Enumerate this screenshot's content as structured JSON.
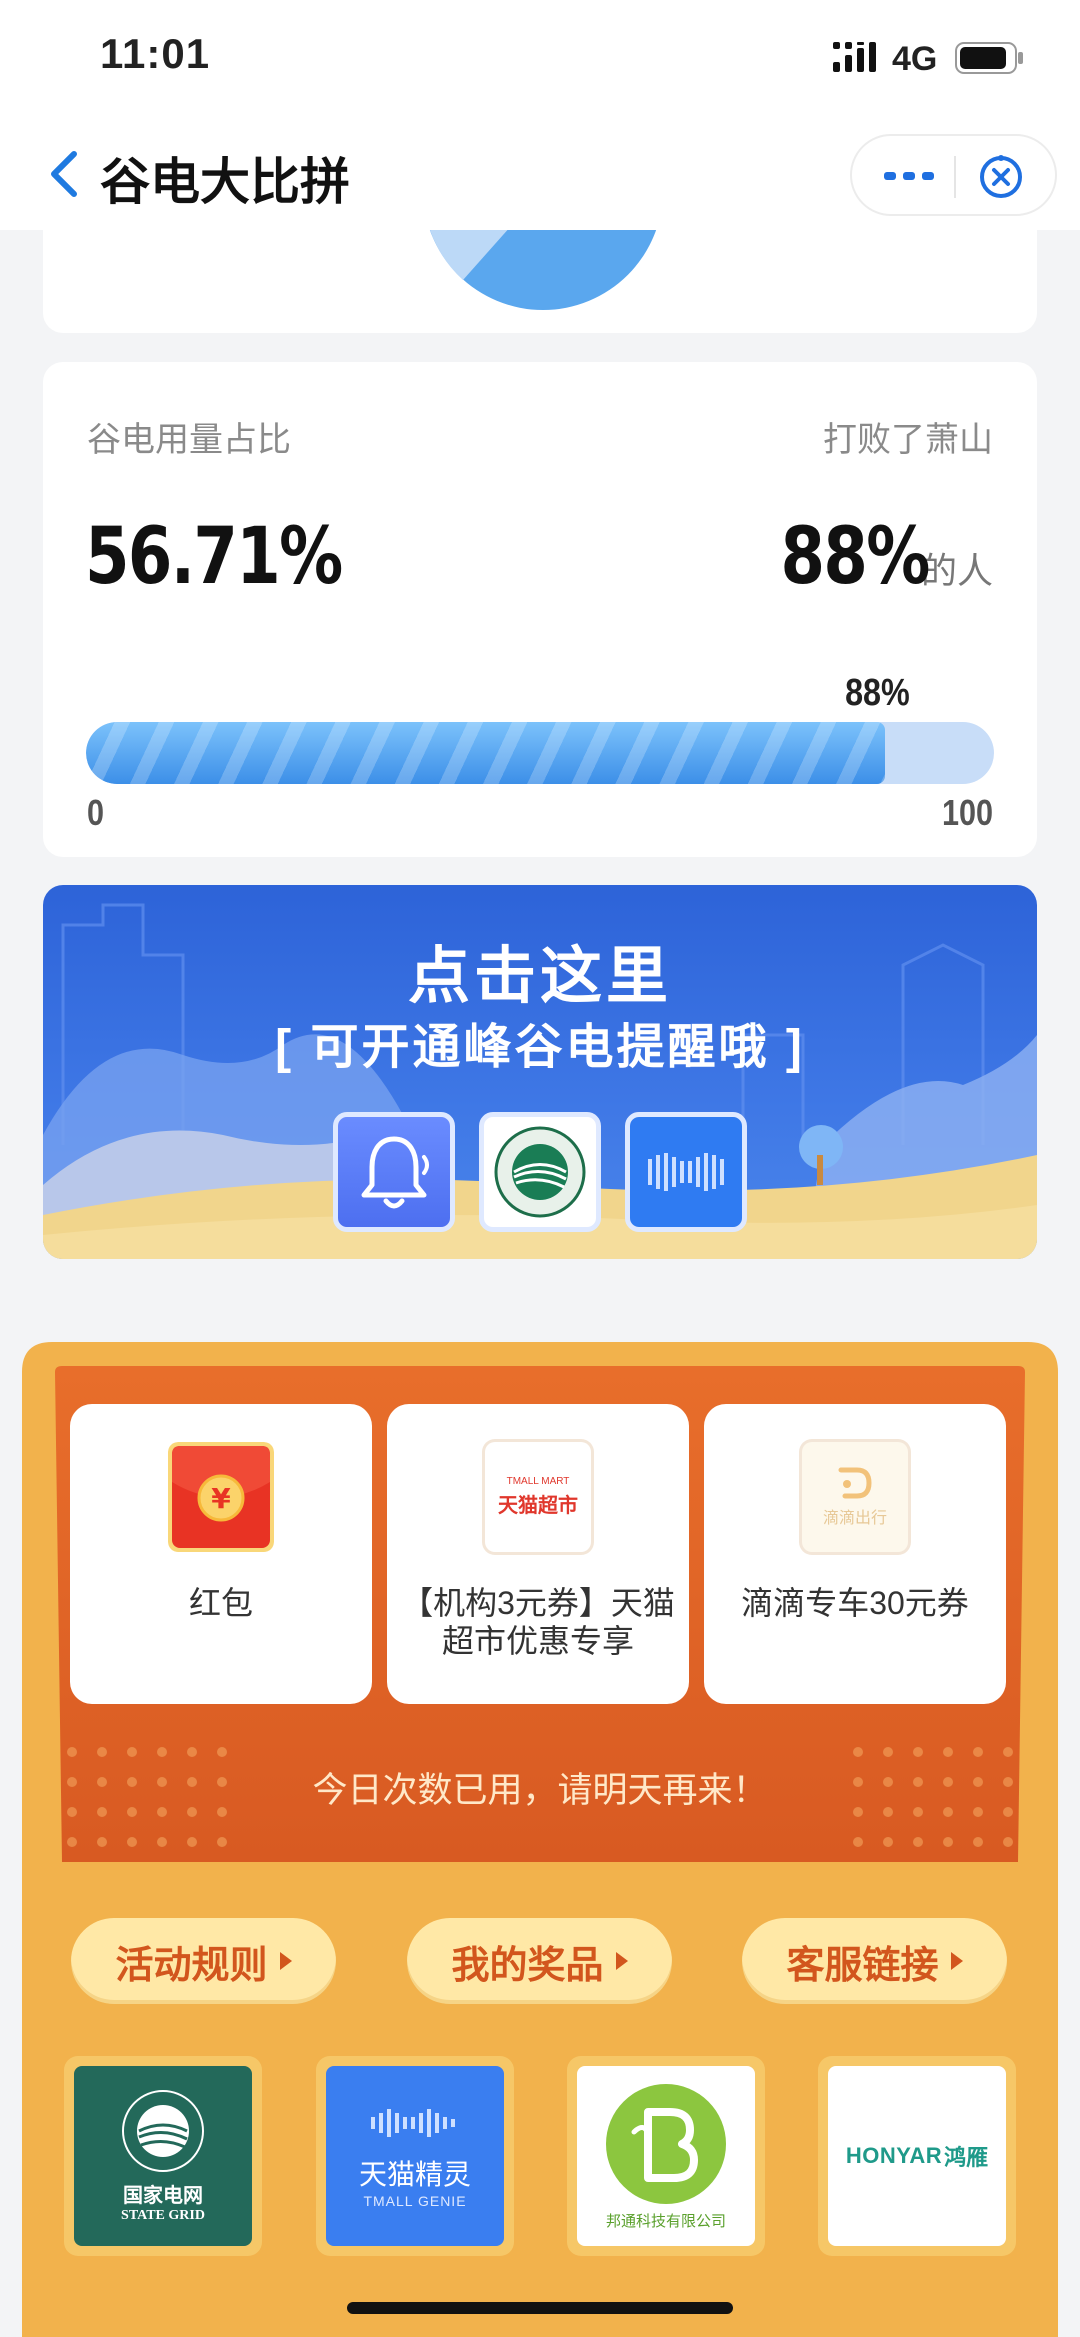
{
  "status_bar": {
    "time": "11:01",
    "network": "4G"
  },
  "nav": {
    "title": "谷电大比拼"
  },
  "stats": {
    "left_label": "谷电用量占比",
    "right_label": "打败了萧山",
    "left_value": "56.71%",
    "right_value": "88%",
    "right_suffix": "的人",
    "progress_label": "88%",
    "progress_fraction": 0.88,
    "progress_min": "0",
    "progress_max": "100"
  },
  "banner": {
    "title": "点击这里",
    "subtitle": "[ 可开通峰谷电提醒哦 ]",
    "icons": [
      "bell-icon",
      "state-grid-logo-icon",
      "tmall-genie-icon"
    ]
  },
  "prizes": {
    "items": [
      {
        "label": "红包",
        "icon": "red-envelope-icon"
      },
      {
        "label": "【机构3元券】天猫超市优惠专享",
        "icon": "tmall-supermarket-logo",
        "logo_text": "天猫超市",
        "logo_small": "TMALL MART"
      },
      {
        "label": "滴滴专车30元券",
        "icon": "didi-logo",
        "logo_text": "滴滴出行"
      }
    ],
    "status": "今日次数已用，请明天再来！"
  },
  "buttons": {
    "rules": "活动规则",
    "my_prizes": "我的奖品",
    "service": "客服链接"
  },
  "partners": {
    "state_grid": {
      "cn": "国家电网",
      "en": "STATE GRID"
    },
    "tmall_genie": {
      "cn": "天猫精灵",
      "en": "TMALL GENIE"
    },
    "bangtong": {
      "cn": "邦通科技有限公司"
    },
    "honyar": {
      "en": "HONYAR",
      "cn": "鸿雁"
    }
  },
  "colors": {
    "accent_blue": "#3c8fe8",
    "panel_orange": "#f2b24c",
    "panel_inner": "#e06a2a",
    "button_text": "#d2561d"
  }
}
